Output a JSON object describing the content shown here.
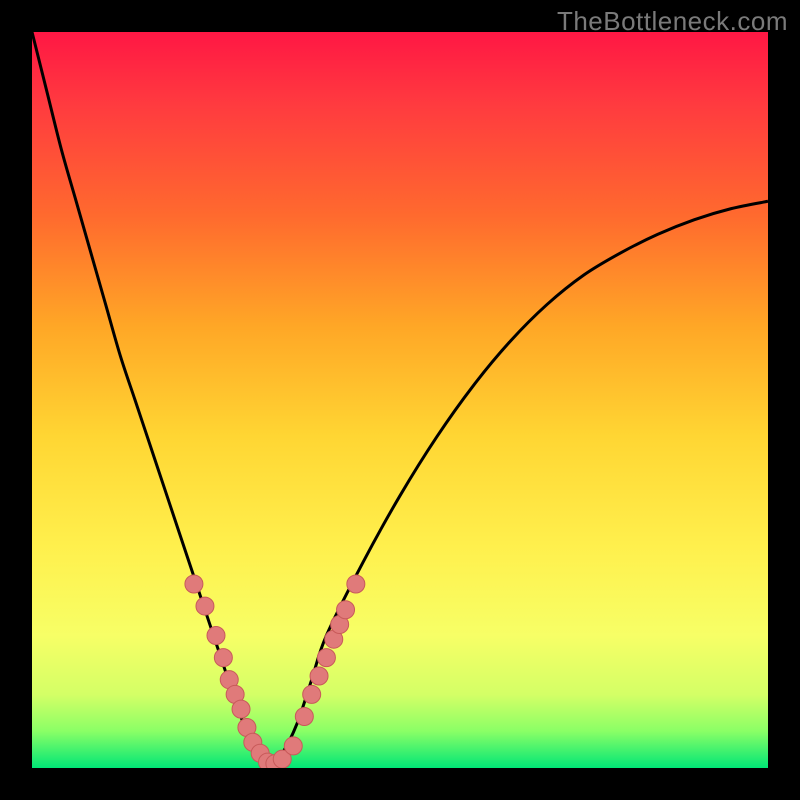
{
  "watermark": "TheBottleneck.com",
  "colors": {
    "frame": "#000000",
    "curve": "#000000",
    "point_fill": "#e07a7a",
    "point_stroke": "#c85a5a",
    "gradient_stops": [
      {
        "offset": 0.0,
        "color": "#ff1744"
      },
      {
        "offset": 0.1,
        "color": "#ff3b3f"
      },
      {
        "offset": 0.25,
        "color": "#ff6a2e"
      },
      {
        "offset": 0.4,
        "color": "#ffa726"
      },
      {
        "offset": 0.55,
        "color": "#ffd633"
      },
      {
        "offset": 0.7,
        "color": "#fff04d"
      },
      {
        "offset": 0.82,
        "color": "#f7ff66"
      },
      {
        "offset": 0.9,
        "color": "#d4ff66"
      },
      {
        "offset": 0.95,
        "color": "#8aff66"
      },
      {
        "offset": 1.0,
        "color": "#00e676"
      }
    ]
  },
  "chart_data": {
    "type": "line",
    "title": "",
    "xlabel": "",
    "ylabel": "",
    "xlim": [
      0,
      100
    ],
    "ylim": [
      0,
      100
    ],
    "series": [
      {
        "name": "bottleneck-curve",
        "x": [
          0,
          2,
          4,
          6,
          8,
          10,
          12,
          14,
          16,
          18,
          20,
          22,
          24,
          26,
          28,
          30,
          32,
          34,
          36,
          38,
          40,
          45,
          50,
          55,
          60,
          65,
          70,
          75,
          80,
          85,
          90,
          95,
          100
        ],
        "y": [
          100,
          92,
          84,
          77,
          70,
          63,
          56,
          50,
          44,
          38,
          32,
          26,
          20,
          14,
          8,
          3,
          0,
          2,
          6,
          12,
          18,
          28,
          37,
          45,
          52,
          58,
          63,
          67,
          70,
          72.5,
          74.5,
          76,
          77
        ]
      }
    ],
    "points": {
      "name": "highlighted-points",
      "x": [
        22,
        23.5,
        25,
        26,
        26.8,
        27.6,
        28.4,
        29.2,
        30,
        31,
        32,
        33,
        34,
        35.5,
        37,
        38,
        39,
        40,
        41,
        41.8,
        42.6,
        44
      ],
      "y": [
        25,
        22,
        18,
        15,
        12,
        10,
        8,
        5.5,
        3.5,
        2,
        0.8,
        0.6,
        1.2,
        3,
        7,
        10,
        12.5,
        15,
        17.5,
        19.5,
        21.5,
        25
      ]
    }
  }
}
